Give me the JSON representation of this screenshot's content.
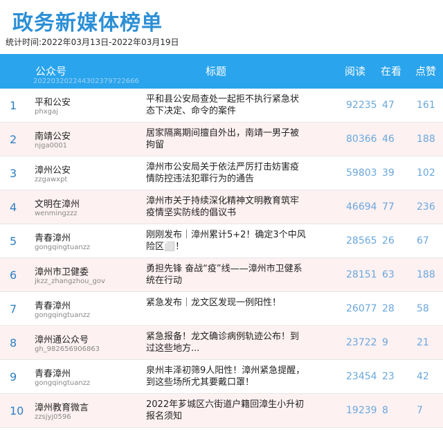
{
  "page": {
    "title": "政务新媒体榜单",
    "stat_time": "统计时间:2022年03月13日-2022年03月19日"
  },
  "table": {
    "headers": {
      "account": "公众号",
      "title": "标题",
      "read": "阅读",
      "watch": "在看",
      "like": "点赞",
      "id_line": "2022032022443023797226​66"
    },
    "rows": [
      {
        "rank": "1",
        "name": "平和公安",
        "id": "phxgaj",
        "title": "平和县公安局查处一起拒不执行紧急状态下决定、命令的案件",
        "read": "92235",
        "watch": "47",
        "like": "161"
      },
      {
        "rank": "2",
        "name": "南靖公安",
        "id": "njga0001",
        "title": "居家隔离期间擅自外出，南靖一男子被拘留",
        "read": "80366",
        "watch": "46",
        "like": "188"
      },
      {
        "rank": "3",
        "name": "漳州公安",
        "id": "zzgawxpt",
        "title": "漳州市公安局关于依法严厉打击妨害疫情防控违法犯罪行为的通告",
        "read": "59803",
        "watch": "39",
        "like": "102"
      },
      {
        "rank": "4",
        "name": "文明在漳州",
        "id": "wenmingzzz",
        "title": "漳州市关于持续深化精神文明教育筑牢疫情坚实防线的倡议书",
        "read": "46694",
        "watch": "77",
        "like": "236"
      },
      {
        "rank": "5",
        "name": "青春漳州",
        "id": "gongqingtuanzz",
        "title": "刚刚发布｜漳州累计5+2！确定3个中风险区⬜！",
        "read": "28565",
        "watch": "26",
        "like": "67"
      },
      {
        "rank": "6",
        "name": "漳州市卫健委",
        "id": "jkzz_zhangzhou_gov",
        "title": "勇担先锋  奋战“疫”线——漳州市卫健系统在行动",
        "read": "28151",
        "watch": "63",
        "like": "188"
      },
      {
        "rank": "7",
        "name": "青春漳州",
        "id": "gongqingtuanzz",
        "title": "紧急发布｜龙文区发现一例阳性！",
        "read": "26077",
        "watch": "28",
        "like": "58"
      },
      {
        "rank": "8",
        "name": "漳州通公众号",
        "id": "gh_982656906863",
        "title": "紧急报备！龙文确诊病例轨迹公布！到过这些地方...",
        "read": "23722",
        "watch": "9",
        "like": "21"
      },
      {
        "rank": "9",
        "name": "青春漳州",
        "id": "gongqingtuanzz",
        "title": "泉州丰泽初筛9人阳性！漳州紧急提醒，到这些场所尤其要戴口罩！",
        "read": "23454",
        "watch": "23",
        "like": "42"
      },
      {
        "rank": "10",
        "name": "漳州教育微言",
        "id": "zzsjyj0596",
        "title": "2022年芗城区六街道户籍回漳生小升初报名须知",
        "read": "19239",
        "watch": "8",
        "like": "7"
      }
    ]
  },
  "colors": {
    "title": "#2c8fd6",
    "header_bg": "#2aa4ec",
    "row_alt_bg": "#fdf1f2",
    "number": "#6aa7dc",
    "rank": "#2d7fc0"
  }
}
